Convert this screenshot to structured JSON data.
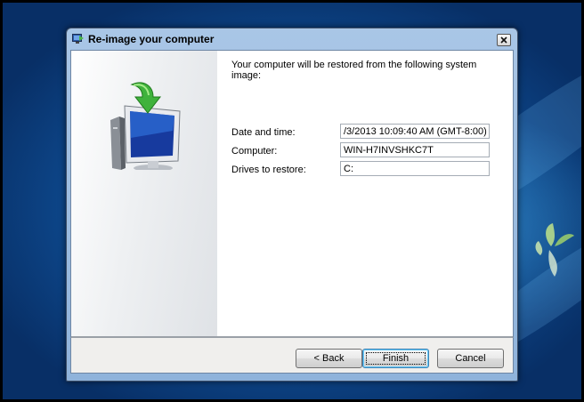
{
  "window": {
    "title": "Re-image your computer",
    "close_glyph": "×"
  },
  "content": {
    "message": "Your computer will be restored from the following system image:",
    "fields": [
      {
        "label": "Date and time:",
        "value": "/3/2013 10:09:40 AM (GMT-8:00)"
      },
      {
        "label": "Computer:",
        "value": "WIN-H7INVSHKC7T"
      },
      {
        "label": "Drives to restore:",
        "value": "C:"
      }
    ]
  },
  "buttons": {
    "back": "< Back",
    "finish": "Finish",
    "cancel": "Cancel"
  },
  "colors": {
    "desktop_blue": "#0f4f97",
    "window_frame": "#a9c6e6",
    "dialog_footer": "#f0efed"
  },
  "icons": {
    "title": "system-image-restore-icon",
    "hero": "computer-restore-arrow-icon",
    "desktop_logo": "windows-logo-icon"
  }
}
